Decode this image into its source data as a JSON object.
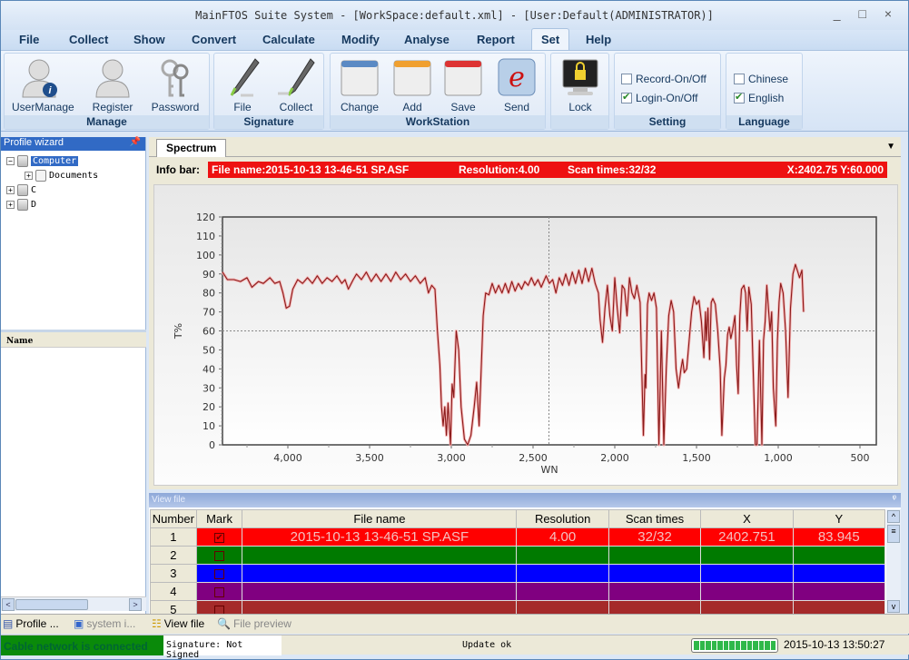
{
  "window": {
    "title": "MainFTOS Suite System - [WorkSpace:default.xml] - [User:Default(ADMINISTRATOR)]",
    "controls": [
      "_",
      "□",
      "×"
    ]
  },
  "menu": {
    "items": [
      "File",
      "Collect",
      "Show",
      "Convert",
      "Calculate",
      "Modify",
      "Analyse",
      "Report",
      "Set",
      "Help"
    ],
    "active": "Set"
  },
  "ribbon": {
    "groups": {
      "manage": {
        "label": "Manage",
        "buttons": [
          "UserManage",
          "Register",
          "Password"
        ]
      },
      "signature": {
        "label": "Signature",
        "buttons": [
          "File",
          "Collect"
        ]
      },
      "workstation": {
        "label": "WorkStation",
        "buttons": [
          "Change",
          "Add",
          "Save",
          "Send"
        ]
      },
      "lock": {
        "label": "",
        "buttons": [
          "Lock"
        ]
      },
      "setting": {
        "label": "Setting",
        "checks": [
          {
            "label": "Record-On/Off",
            "checked": false
          },
          {
            "label": "Login-On/Off",
            "checked": true
          }
        ]
      },
      "language": {
        "label": "Language",
        "checks": [
          {
            "label": "Chinese",
            "checked": false
          },
          {
            "label": "English",
            "checked": true
          }
        ]
      }
    }
  },
  "profile_wizard": {
    "title": "Profile wizard",
    "tree": [
      {
        "label": "Computer",
        "expanded": true,
        "selected": true
      },
      {
        "label": "Documents",
        "expanded": false
      },
      {
        "label": "C",
        "expanded": false
      },
      {
        "label": "D",
        "expanded": false
      }
    ],
    "name_header": "Name"
  },
  "left_tabs": [
    "Profile ...",
    "system i..."
  ],
  "spectrum": {
    "tab": "Spectrum",
    "info_label": "Info bar:",
    "file_name": "File name:2015-10-13 13-46-51 SP.ASF",
    "resolution": "Resolution:4.00",
    "scan_times": "Scan times:32/32",
    "cursor": "X:2402.75 Y:60.000"
  },
  "chart_data": {
    "type": "line",
    "title": "",
    "xlabel": "WN",
    "ylabel": "T%",
    "xlim": [
      4400,
      400
    ],
    "ylim": [
      0,
      120
    ],
    "x_ticks": [
      4000,
      3500,
      3000,
      2500,
      2000,
      1500,
      1000,
      500
    ],
    "x_tick_labels": [
      "4,000",
      "3,500",
      "3,000",
      "2,500",
      "2,000",
      "1,500",
      "1,000",
      "500"
    ],
    "y_ticks": [
      0,
      10,
      20,
      30,
      40,
      50,
      60,
      70,
      80,
      90,
      100,
      110,
      120
    ],
    "cursor": {
      "x": 2402.75,
      "y": 60.0
    },
    "series": [
      {
        "name": "2015-10-13 13-46-51 SP.ASF",
        "color": "#cc2222",
        "points": [
          [
            4400,
            91
          ],
          [
            4370,
            87
          ],
          [
            4330,
            87
          ],
          [
            4290,
            86
          ],
          [
            4250,
            88
          ],
          [
            4220,
            83
          ],
          [
            4180,
            86
          ],
          [
            4150,
            85
          ],
          [
            4110,
            88
          ],
          [
            4080,
            85
          ],
          [
            4050,
            86
          ],
          [
            4030,
            80
          ],
          [
            4010,
            72
          ],
          [
            3990,
            73
          ],
          [
            3970,
            82
          ],
          [
            3940,
            87
          ],
          [
            3910,
            85
          ],
          [
            3880,
            88
          ],
          [
            3850,
            85
          ],
          [
            3820,
            89
          ],
          [
            3790,
            85
          ],
          [
            3760,
            88
          ],
          [
            3730,
            86
          ],
          [
            3700,
            89
          ],
          [
            3670,
            85
          ],
          [
            3650,
            87
          ],
          [
            3630,
            82
          ],
          [
            3600,
            87
          ],
          [
            3580,
            90
          ],
          [
            3550,
            87
          ],
          [
            3520,
            91
          ],
          [
            3490,
            86
          ],
          [
            3460,
            90
          ],
          [
            3430,
            86
          ],
          [
            3400,
            90
          ],
          [
            3370,
            86
          ],
          [
            3340,
            91
          ],
          [
            3310,
            87
          ],
          [
            3280,
            90
          ],
          [
            3250,
            86
          ],
          [
            3220,
            89
          ],
          [
            3190,
            85
          ],
          [
            3160,
            88
          ],
          [
            3140,
            80
          ],
          [
            3120,
            84
          ],
          [
            3100,
            82
          ],
          [
            3085,
            60
          ],
          [
            3070,
            42
          ],
          [
            3060,
            20
          ],
          [
            3050,
            10
          ],
          [
            3040,
            20
          ],
          [
            3030,
            5
          ],
          [
            3020,
            22
          ],
          [
            3005,
            0
          ],
          [
            2995,
            32
          ],
          [
            2985,
            25
          ],
          [
            2970,
            60
          ],
          [
            2955,
            50
          ],
          [
            2940,
            20
          ],
          [
            2920,
            3
          ],
          [
            2900,
            0
          ],
          [
            2880,
            5
          ],
          [
            2860,
            20
          ],
          [
            2845,
            33
          ],
          [
            2830,
            10
          ],
          [
            2815,
            45
          ],
          [
            2805,
            68
          ],
          [
            2790,
            80
          ],
          [
            2770,
            79
          ],
          [
            2750,
            85
          ],
          [
            2730,
            80
          ],
          [
            2710,
            84
          ],
          [
            2690,
            80
          ],
          [
            2670,
            85
          ],
          [
            2650,
            80
          ],
          [
            2630,
            86
          ],
          [
            2610,
            81
          ],
          [
            2590,
            85
          ],
          [
            2570,
            82
          ],
          [
            2550,
            86
          ],
          [
            2530,
            84
          ],
          [
            2510,
            88
          ],
          [
            2490,
            84
          ],
          [
            2470,
            87
          ],
          [
            2450,
            83
          ],
          [
            2420,
            89
          ],
          [
            2400,
            85
          ],
          [
            2380,
            87
          ],
          [
            2360,
            80
          ],
          [
            2340,
            88
          ],
          [
            2320,
            84
          ],
          [
            2300,
            90
          ],
          [
            2280,
            84
          ],
          [
            2260,
            91
          ],
          [
            2240,
            85
          ],
          [
            2220,
            92
          ],
          [
            2200,
            85
          ],
          [
            2180,
            93
          ],
          [
            2160,
            86
          ],
          [
            2140,
            93
          ],
          [
            2120,
            85
          ],
          [
            2100,
            80
          ],
          [
            2090,
            66
          ],
          [
            2075,
            54
          ],
          [
            2060,
            72
          ],
          [
            2045,
            84
          ],
          [
            2030,
            68
          ],
          [
            2015,
            60
          ],
          [
            2000,
            88
          ],
          [
            1985,
            72
          ],
          [
            1970,
            59
          ],
          [
            1955,
            84
          ],
          [
            1940,
            82
          ],
          [
            1925,
            68
          ],
          [
            1910,
            88
          ],
          [
            1895,
            80
          ],
          [
            1880,
            77
          ],
          [
            1865,
            84
          ],
          [
            1845,
            75
          ],
          [
            1825,
            5
          ],
          [
            1815,
            37
          ],
          [
            1810,
            30
          ],
          [
            1800,
            74
          ],
          [
            1790,
            80
          ],
          [
            1775,
            76
          ],
          [
            1760,
            80
          ],
          [
            1745,
            72
          ],
          [
            1730,
            0
          ],
          [
            1715,
            60
          ],
          [
            1700,
            0
          ],
          [
            1685,
            40
          ],
          [
            1670,
            68
          ],
          [
            1655,
            76
          ],
          [
            1640,
            70
          ],
          [
            1625,
            40
          ],
          [
            1610,
            30
          ],
          [
            1595,
            40
          ],
          [
            1585,
            45
          ],
          [
            1575,
            38
          ],
          [
            1560,
            40
          ],
          [
            1545,
            55
          ],
          [
            1530,
            70
          ],
          [
            1515,
            78
          ],
          [
            1500,
            74
          ],
          [
            1485,
            76
          ],
          [
            1470,
            65
          ],
          [
            1455,
            46
          ],
          [
            1445,
            70
          ],
          [
            1440,
            55
          ],
          [
            1430,
            72
          ],
          [
            1420,
            45
          ],
          [
            1410,
            75
          ],
          [
            1400,
            77
          ],
          [
            1385,
            74
          ],
          [
            1370,
            60
          ],
          [
            1355,
            40
          ],
          [
            1345,
            5
          ],
          [
            1330,
            35
          ],
          [
            1320,
            42
          ],
          [
            1310,
            58
          ],
          [
            1300,
            62
          ],
          [
            1290,
            56
          ],
          [
            1280,
            60
          ],
          [
            1265,
            68
          ],
          [
            1255,
            42
          ],
          [
            1245,
            27
          ],
          [
            1235,
            68
          ],
          [
            1225,
            82
          ],
          [
            1210,
            84
          ],
          [
            1200,
            80
          ],
          [
            1190,
            60
          ],
          [
            1180,
            83
          ],
          [
            1165,
            74
          ],
          [
            1150,
            30
          ],
          [
            1140,
            0
          ],
          [
            1130,
            0
          ],
          [
            1115,
            55
          ],
          [
            1100,
            0
          ],
          [
            1090,
            55
          ],
          [
            1080,
            65
          ],
          [
            1070,
            84
          ],
          [
            1060,
            72
          ],
          [
            1050,
            60
          ],
          [
            1040,
            70
          ],
          [
            1030,
            30
          ],
          [
            1015,
            10
          ],
          [
            1005,
            55
          ],
          [
            995,
            75
          ],
          [
            985,
            85
          ],
          [
            970,
            80
          ],
          [
            955,
            60
          ],
          [
            940,
            25
          ],
          [
            925,
            72
          ],
          [
            910,
            90
          ],
          [
            895,
            95
          ],
          [
            880,
            91
          ],
          [
            870,
            88
          ],
          [
            855,
            92
          ],
          [
            845,
            70
          ]
        ]
      }
    ]
  },
  "view_file": {
    "title": "View file",
    "columns": [
      "Number",
      "Mark",
      "File name",
      "Resolution",
      "Scan times",
      "X",
      "Y"
    ],
    "rows": [
      {
        "number": "1",
        "mark": true,
        "file_name": "2015-10-13 13-46-51 SP.ASF",
        "resolution": "4.00",
        "scan_times": "32/32",
        "x": "2402.751",
        "y": "83.945",
        "color": "#ff0000"
      },
      {
        "number": "2",
        "mark": false,
        "file_name": "",
        "resolution": "",
        "scan_times": "",
        "x": "",
        "y": "",
        "color": "#007a00"
      },
      {
        "number": "3",
        "mark": false,
        "file_name": "",
        "resolution": "",
        "scan_times": "",
        "x": "",
        "y": "",
        "color": "#0000ff"
      },
      {
        "number": "4",
        "mark": false,
        "file_name": "",
        "resolution": "",
        "scan_times": "",
        "x": "",
        "y": "",
        "color": "#800080"
      },
      {
        "number": "5",
        "mark": false,
        "file_name": "",
        "resolution": "",
        "scan_times": "",
        "x": "",
        "y": "",
        "color": "#a52a2a"
      }
    ]
  },
  "bottom_tabs": [
    "View file",
    "File preview"
  ],
  "status": {
    "network": "Cable network is connected",
    "signature": "Signature: Not Signed",
    "message": "Update ok",
    "progress": 1.0,
    "datetime": "2015-10-13 13:50:27"
  }
}
